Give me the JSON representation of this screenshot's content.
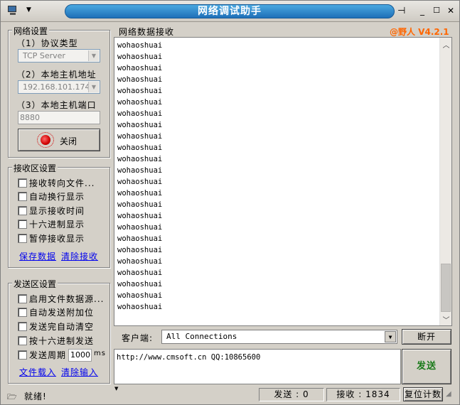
{
  "window": {
    "title": "网络调试助手",
    "version": "@野人 V4.2.1"
  },
  "net_settings": {
    "title": "网络设置",
    "protocol_label": "（1）协议类型",
    "protocol_value": "TCP Server",
    "host_label": "（2）本地主机地址",
    "host_value": "192.168.101.174",
    "port_label": "（3）本地主机端口",
    "port_value": "8880",
    "close_button": "关闭"
  },
  "recv_settings": {
    "title": "接收区设置",
    "options": [
      "接收转向文件...",
      "自动换行显示",
      "显示接收时间",
      "十六进制显示",
      "暂停接收显示"
    ],
    "save_link": "保存数据",
    "clear_link": "清除接收"
  },
  "send_settings": {
    "title": "发送区设置",
    "options": [
      "启用文件数据源...",
      "自动发送附加位",
      "发送完自动清空",
      "按十六进制发送"
    ],
    "period_label": "发送周期",
    "period_value": "1000",
    "period_unit": "ms",
    "load_link": "文件载入",
    "clear_link": "清除输入"
  },
  "receive": {
    "title": "网络数据接收",
    "lines": [
      "wohaoshuai",
      "wohaoshuai",
      "wohaoshuai",
      "wohaoshuai",
      "wohaoshuai",
      "wohaoshuai",
      "wohaoshuai",
      "wohaoshuai",
      "wohaoshuai",
      "wohaoshuai",
      "wohaoshuai",
      "wohaoshuai",
      "wohaoshuai",
      "wohaoshuai",
      "wohaoshuai",
      "wohaoshuai",
      "wohaoshuai",
      "wohaoshuai",
      "wohaoshuai",
      "wohaoshuai",
      "wohaoshuai",
      "wohaoshuai",
      "wohaoshuai",
      "wohaoshuai"
    ]
  },
  "client": {
    "label": "客户端:",
    "value": "All Connections",
    "disconnect_button": "断开"
  },
  "send": {
    "text": "http://www.cmsoft.cn QQ:10865600",
    "button": "发送"
  },
  "status": {
    "ready": "就绪!",
    "sent_label": "发送 : 0",
    "recv_label": "接收 : 1834",
    "reset_button": "复位计数"
  },
  "colors": {
    "title_bar": "#2a84cc",
    "version": "#ff6600",
    "send_button_text": "#1a7a1a",
    "link": "#0000ee"
  }
}
